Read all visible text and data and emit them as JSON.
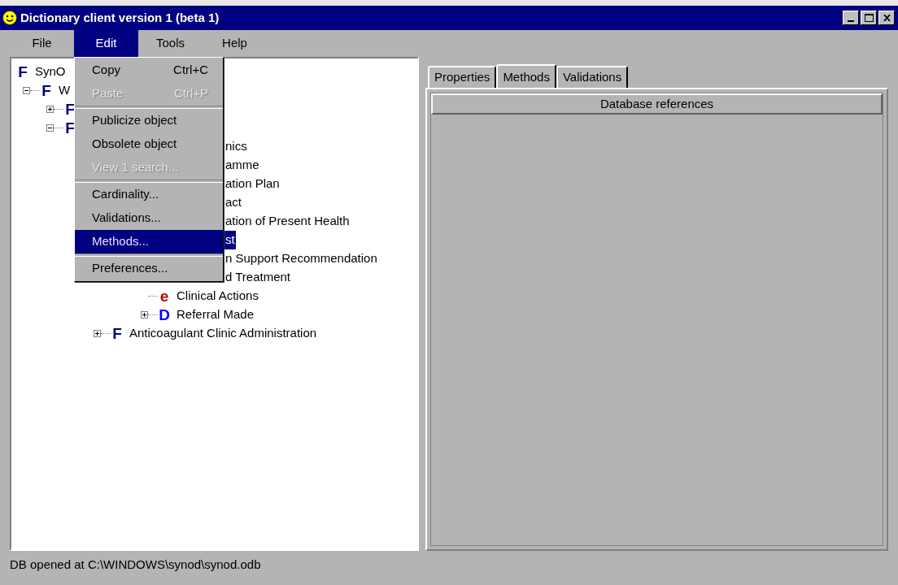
{
  "window": {
    "title": "Dictionary client version 1 (beta 1)"
  },
  "menu_bar": [
    {
      "label": "File",
      "selected": false
    },
    {
      "label": "Edit",
      "selected": true
    },
    {
      "label": "Tools",
      "selected": false
    },
    {
      "label": "Help",
      "selected": false
    }
  ],
  "edit_menu": [
    {
      "kind": "item",
      "label": "Copy",
      "shortcut": "Ctrl+C",
      "disabled": false,
      "selected": false
    },
    {
      "kind": "item",
      "label": "Paste",
      "shortcut": "Ctrl+P",
      "disabled": true,
      "selected": false
    },
    {
      "kind": "separator"
    },
    {
      "kind": "item",
      "label": "Publicize object",
      "disabled": false,
      "selected": false
    },
    {
      "kind": "item",
      "label": "Obsolete object",
      "disabled": false,
      "selected": false
    },
    {
      "kind": "item",
      "label": "View 1 search...",
      "disabled": true,
      "selected": false
    },
    {
      "kind": "separator"
    },
    {
      "kind": "item",
      "label": "Cardinality...",
      "disabled": false,
      "selected": false
    },
    {
      "kind": "item",
      "label": "Validations...",
      "disabled": false,
      "selected": false
    },
    {
      "kind": "item",
      "label": "Methods...",
      "disabled": false,
      "selected": true
    },
    {
      "kind": "separator"
    },
    {
      "kind": "item",
      "label": "Preferences...",
      "disabled": false,
      "selected": false
    }
  ],
  "tree": [
    {
      "icon": "F",
      "color": "#000080",
      "label": "SynO",
      "selected": false,
      "children": [
        {
          "icon": "F",
          "color": "#000080",
          "label": "W",
          "expanded": true,
          "selected": false,
          "children": [
            {
              "icon": "F",
              "color": "#000080",
              "expanded": false
            },
            {
              "icon": "F",
              "color": "#000080",
              "expanded": true,
              "children": [
                {
                  "label": "nics",
                  "selected": false,
                  "children": [
                    {
                      "label": "amme",
                      "selected": false
                    },
                    {
                      "label": "ation Plan",
                      "selected": false
                    },
                    {
                      "label": "act",
                      "selected": false
                    },
                    {
                      "label": "ation of Present Health",
                      "selected": false
                    },
                    {
                      "label": "st",
                      "selected": true
                    },
                    {
                      "label": "n Support Recommendation",
                      "selected": false,
                      "children": [
                        {
                          "label": "d Treatment",
                          "selected": false,
                          "children": [
                            {
                              "icon": "e",
                              "color": "#b00000",
                              "label": "Clinical Actions",
                              "selected": false
                            },
                            {
                              "icon": "D",
                              "color": "#0000ff",
                              "label": "Referral Made",
                              "expanded": false,
                              "selected": false
                            }
                          ]
                        }
                      ]
                    },
                    {
                      "icon": "F",
                      "color": "#000080",
                      "label": "Anticoagulant Clinic Administration",
                      "expanded": false,
                      "selected": false
                    }
                  ]
                }
              ]
            }
          ]
        }
      ]
    }
  ],
  "tabs": [
    {
      "label": "Properties",
      "selected": false
    },
    {
      "label": "Methods",
      "selected": true
    },
    {
      "label": "Validations",
      "selected": false
    }
  ],
  "table": {
    "columns": [
      "Database references"
    ]
  },
  "status_bar": "DB opened at C:\\WINDOWS\\synod\\synod.odb"
}
